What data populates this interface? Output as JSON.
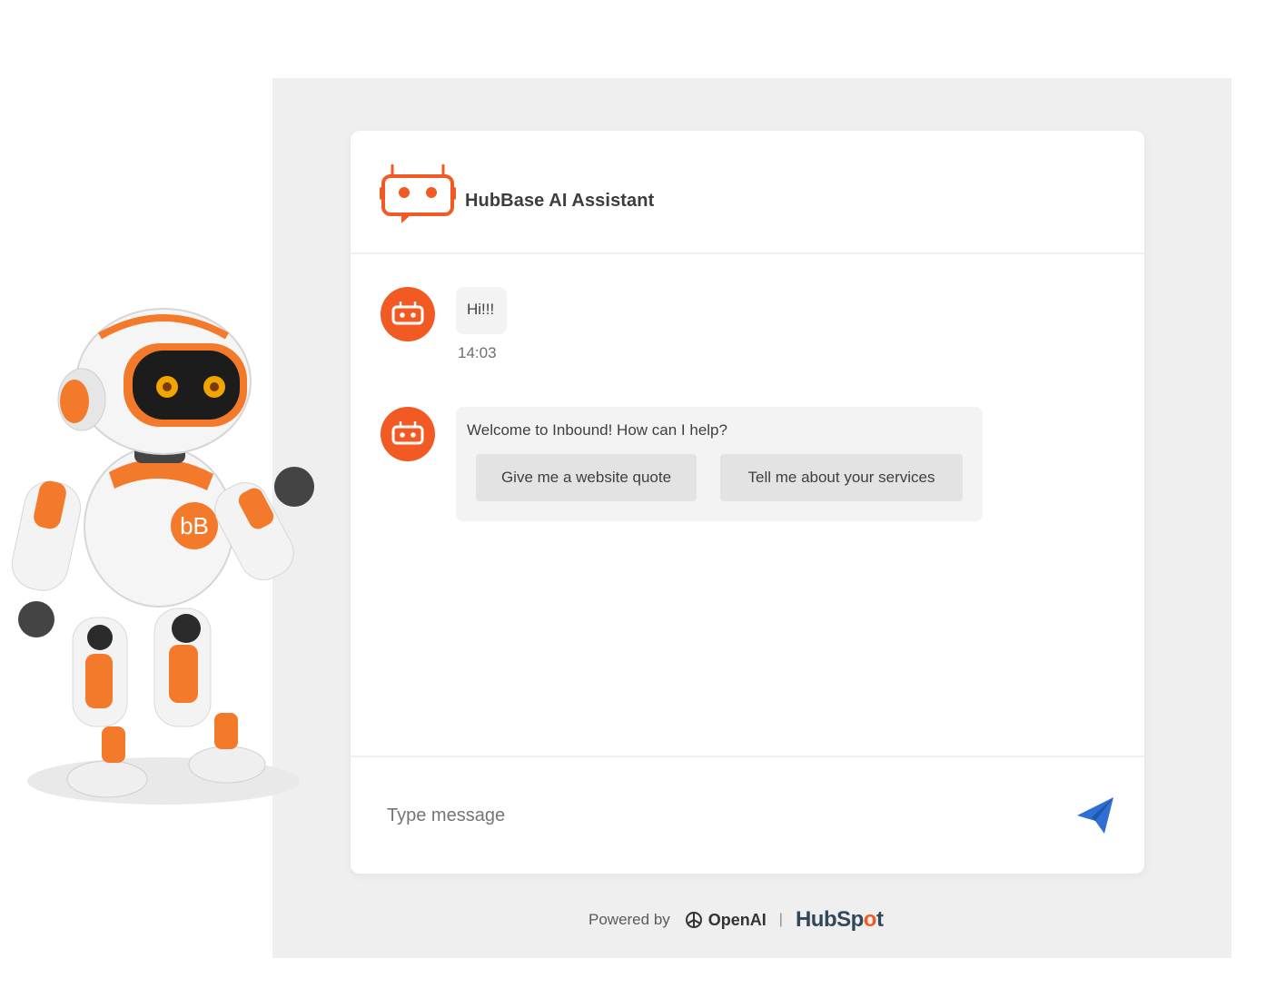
{
  "header": {
    "title": "HubBase AI Assistant"
  },
  "messages": [
    {
      "text": "Hi!!!",
      "time": "14:03"
    },
    {
      "text": "Welcome to Inbound! How can I help?",
      "quick_replies": [
        "Give me a website quote",
        "Tell me about your services"
      ]
    }
  ],
  "composer": {
    "placeholder": "Type message",
    "value": ""
  },
  "footer": {
    "powered_by": "Powered by",
    "openai": "OpenAI",
    "separator": "|",
    "hubspot_pre": "HubSp",
    "hubspot_o": "o",
    "hubspot_post": "t"
  },
  "mascot": {
    "badge": "bB"
  },
  "colors": {
    "accent": "#f15a22",
    "send": "#2f6fd1",
    "panel": "#efefef"
  },
  "icons": {
    "header": "robot-chat-icon",
    "avatar": "bot-avatar-icon",
    "send": "send-icon",
    "openai": "openai-logo-icon"
  }
}
